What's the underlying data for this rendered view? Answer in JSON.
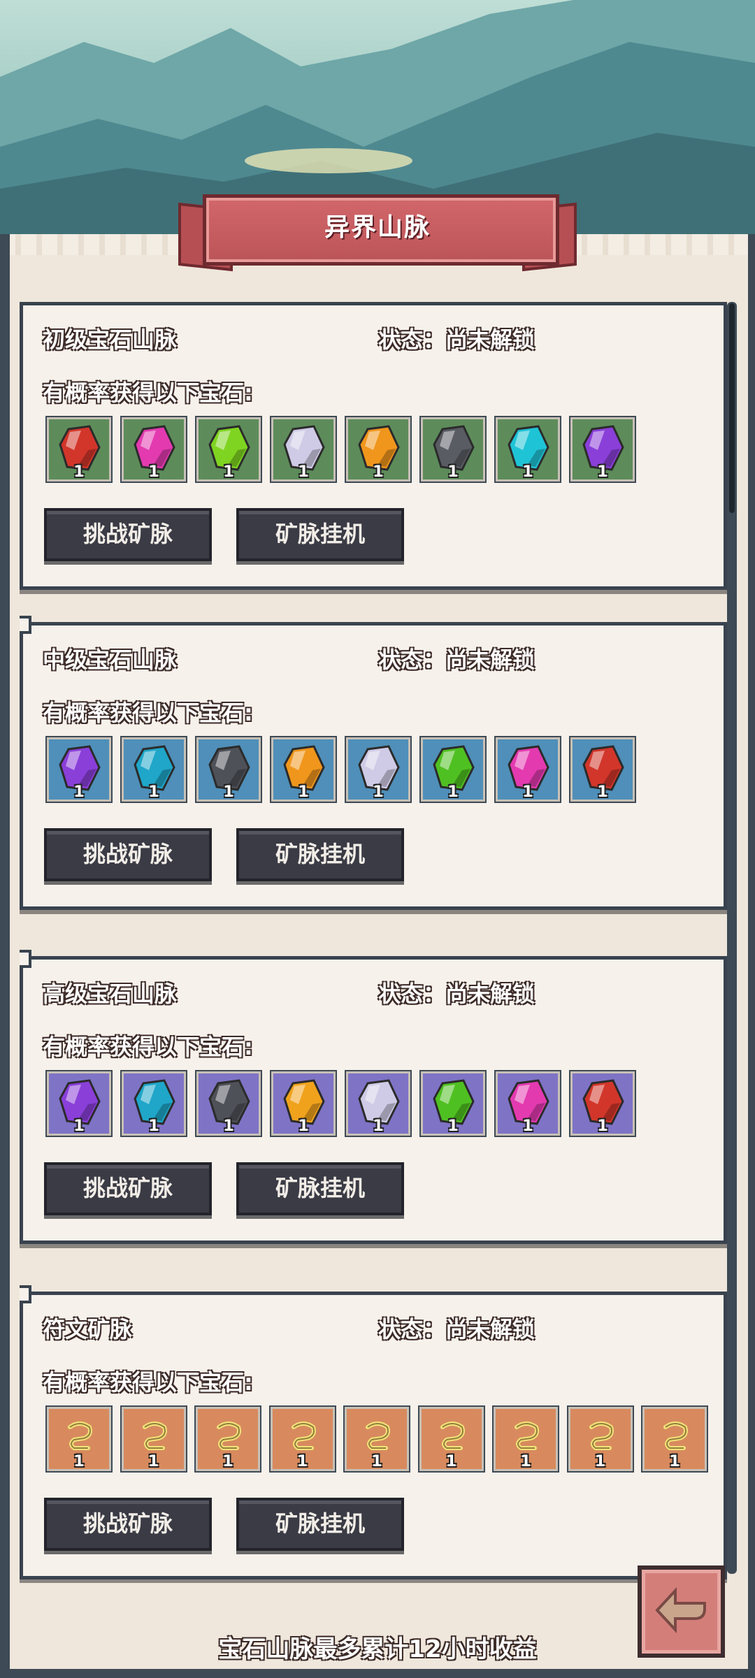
{
  "header": {
    "title": "异界山脉"
  },
  "colors": {
    "card_bg": "#f7f1eb",
    "card_border": "#39434f",
    "tier_bg": [
      "#5d8c5a",
      "#4f8fb9",
      "#7f73c6",
      "#d88a5e"
    ],
    "button_bg": "#3a3b45",
    "banner": "#c95d61"
  },
  "sections": [
    {
      "name": "初级宝石山脉",
      "status": "状态：尚未解锁",
      "prob_label": "有概率获得以下宝石:",
      "item_bg": "#5d8c5a",
      "items": [
        {
          "icon": "red-gem-icon",
          "color": "#d2362a",
          "qty": "1"
        },
        {
          "icon": "pink-gem-icon",
          "color": "#e33ab0",
          "qty": "1"
        },
        {
          "icon": "green-gem-icon",
          "color": "#7fd421",
          "qty": "1"
        },
        {
          "icon": "white-gem-icon",
          "color": "#cfcbe6",
          "qty": "1"
        },
        {
          "icon": "orange-gem-icon",
          "color": "#f0961c",
          "qty": "1"
        },
        {
          "icon": "black-gem-icon",
          "color": "#5a5c64",
          "qty": "1"
        },
        {
          "icon": "cyan-gem-icon",
          "color": "#1fc3d6",
          "qty": "1"
        },
        {
          "icon": "purple-gem-icon",
          "color": "#8a3fd9",
          "qty": "1"
        }
      ],
      "challenge_label": "挑战矿脉",
      "idle_label": "矿脉挂机"
    },
    {
      "name": "中级宝石山脉",
      "status": "状态：尚未解锁",
      "prob_label": "有概率获得以下宝石:",
      "item_bg": "#4f8fb9",
      "items": [
        {
          "icon": "purple-gem-icon",
          "color": "#8a3fd9",
          "qty": "1"
        },
        {
          "icon": "cyan-gem-icon",
          "color": "#1fa6c9",
          "qty": "1"
        },
        {
          "icon": "black-gem-icon",
          "color": "#4f5159",
          "qty": "1"
        },
        {
          "icon": "orange-gem-icon",
          "color": "#f0961c",
          "qty": "1"
        },
        {
          "icon": "white-gem-icon",
          "color": "#cfcbe6",
          "qty": "1"
        },
        {
          "icon": "green-gem-icon",
          "color": "#4fc021",
          "qty": "1"
        },
        {
          "icon": "pink-gem-icon",
          "color": "#e33ab0",
          "qty": "1"
        },
        {
          "icon": "red-gem-icon",
          "color": "#d2362a",
          "qty": "1"
        }
      ],
      "challenge_label": "挑战矿脉",
      "idle_label": "矿脉挂机"
    },
    {
      "name": "高级宝石山脉",
      "status": "状态：尚未解锁",
      "prob_label": "有概率获得以下宝石:",
      "item_bg": "#7f73c6",
      "items": [
        {
          "icon": "purple-gem-icon",
          "color": "#8a3fd9",
          "qty": "1"
        },
        {
          "icon": "cyan-gem-icon",
          "color": "#1fa6c9",
          "qty": "1"
        },
        {
          "icon": "black-gem-icon",
          "color": "#4f5159",
          "qty": "1"
        },
        {
          "icon": "orange-gem-icon",
          "color": "#f0a21c",
          "qty": "1"
        },
        {
          "icon": "white-gem-icon",
          "color": "#cfcbe6",
          "qty": "1"
        },
        {
          "icon": "green-gem-icon",
          "color": "#4fc021",
          "qty": "1"
        },
        {
          "icon": "pink-gem-icon",
          "color": "#e33ab0",
          "qty": "1"
        },
        {
          "icon": "red-gem-icon",
          "color": "#d2362a",
          "qty": "1"
        }
      ],
      "challenge_label": "挑战矿脉",
      "idle_label": "矿脉挂机"
    },
    {
      "name": "符文矿脉",
      "status": "状态：尚未解锁",
      "prob_label": "有概率获得以下宝石:",
      "item_bg": "#d88a5e",
      "items": [
        {
          "icon": "rune-icon",
          "color": "#f1e37a",
          "qty": "1"
        },
        {
          "icon": "rune-icon",
          "color": "#f1e37a",
          "qty": "1"
        },
        {
          "icon": "rune-icon",
          "color": "#f1e37a",
          "qty": "1"
        },
        {
          "icon": "rune-icon",
          "color": "#f1e37a",
          "qty": "1"
        },
        {
          "icon": "rune-icon",
          "color": "#f1e37a",
          "qty": "1"
        },
        {
          "icon": "rune-icon",
          "color": "#f1e37a",
          "qty": "1"
        },
        {
          "icon": "rune-icon",
          "color": "#f1e37a",
          "qty": "1"
        },
        {
          "icon": "rune-icon",
          "color": "#f1e37a",
          "qty": "1"
        },
        {
          "icon": "rune-icon",
          "color": "#f1e37a",
          "qty": "1"
        }
      ],
      "challenge_label": "挑战矿脉",
      "idle_label": "矿脉挂机"
    }
  ],
  "footer": {
    "note": "宝石山脉最多累计12小时收益",
    "back_icon": "back-arrow-icon"
  }
}
